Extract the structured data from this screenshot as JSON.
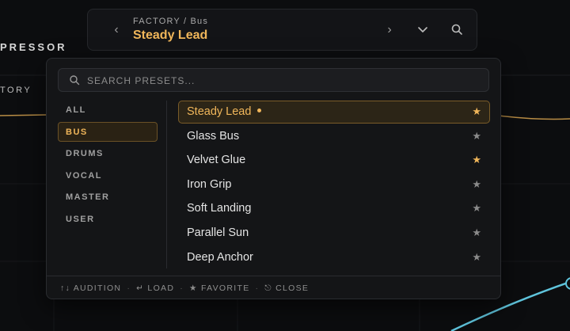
{
  "background": {
    "plugin_title": "PRESSOR",
    "section_label": "TORY"
  },
  "header": {
    "breadcrumb": "FACTORY / Bus",
    "preset_name": "Steady Lead",
    "prev_icon": "chevron-left-icon",
    "next_icon": "chevron-right-icon",
    "dropdown_icon": "chevron-down-icon",
    "search_icon": "search-icon"
  },
  "browser": {
    "search": {
      "placeholder": "SEARCH PRESETS...",
      "value": ""
    },
    "categories": [
      {
        "label": "ALL",
        "active": false
      },
      {
        "label": "BUS",
        "active": true
      },
      {
        "label": "DRUMS",
        "active": false
      },
      {
        "label": "VOCAL",
        "active": false
      },
      {
        "label": "MASTER",
        "active": false
      },
      {
        "label": "USER",
        "active": false
      }
    ],
    "presets": [
      {
        "label": "Steady Lead",
        "active": true,
        "loaded": true,
        "favorite": true
      },
      {
        "label": "Glass Bus",
        "active": false,
        "loaded": false,
        "favorite": false
      },
      {
        "label": "Velvet Glue",
        "active": false,
        "loaded": false,
        "favorite": true
      },
      {
        "label": "Iron Grip",
        "active": false,
        "loaded": false,
        "favorite": false
      },
      {
        "label": "Soft Landing",
        "active": false,
        "loaded": false,
        "favorite": false
      },
      {
        "label": "Parallel Sun",
        "active": false,
        "loaded": false,
        "favorite": false
      },
      {
        "label": "Deep Anchor",
        "active": false,
        "loaded": false,
        "favorite": false
      }
    ],
    "footer": {
      "audition": "↑↓ AUDITION",
      "load": "↵ LOAD",
      "favorite": "★ FAVORITE",
      "close": "⎋ CLOSE",
      "separator": "·"
    }
  },
  "colors": {
    "accent": "#f0b65a",
    "curve": "#5fc4dc",
    "panel": "#141517"
  }
}
